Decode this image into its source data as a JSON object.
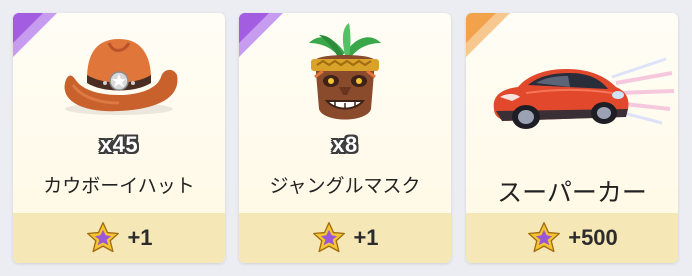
{
  "cards": [
    {
      "count": "x45",
      "name": "カウボーイハット",
      "icon": "cowboy-hat-icon",
      "corner_color": "#a35de0",
      "reward": "+1"
    },
    {
      "count": "x8",
      "name": "ジャングルマスク",
      "icon": "jungle-mask-icon",
      "corner_color": "#a35de0",
      "reward": "+1"
    },
    {
      "count": "",
      "name": "スーパーカー",
      "icon": "supercar-icon",
      "corner_color": "#f2a24a",
      "reward": "+500"
    }
  ],
  "reward_icon": "star-icon",
  "colors": {
    "reward_bar": "#f6e8b6",
    "star_outer": "#f5c431",
    "star_inner": "#9a58d6"
  }
}
